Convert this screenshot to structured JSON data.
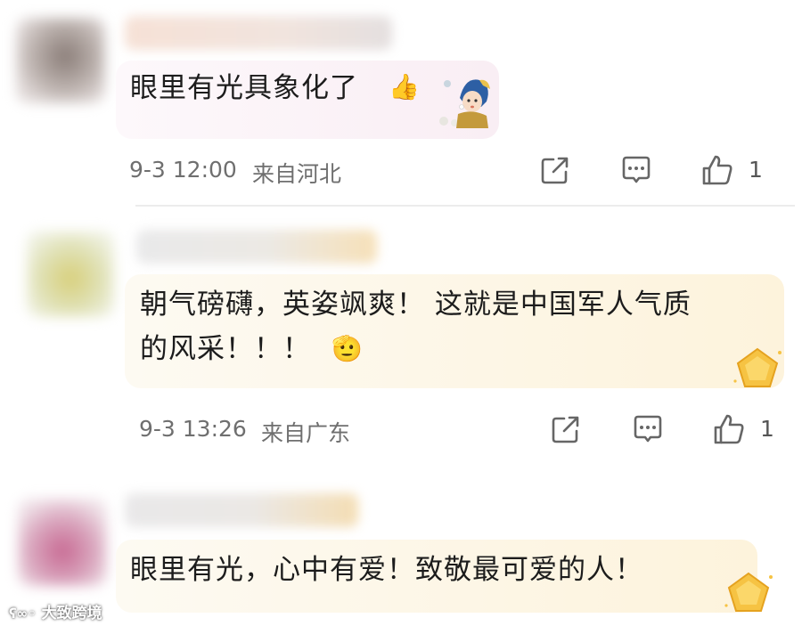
{
  "comments": [
    {
      "text_lines": [
        "眼里有光具象化了"
      ],
      "emojis": [
        "thumbs-up",
        "girl-with-pearl-earring-sticker"
      ],
      "time": "9-3 12:00",
      "location": "来自河北",
      "likes": "1"
    },
    {
      "text_lines": [
        "朝气磅礴，英姿飒爽！ 这就是中国军人气质",
        "的风采！！！"
      ],
      "emojis": [
        "salute-face"
      ],
      "time": "9-3 13:26",
      "location": "来自广东",
      "likes": "1",
      "badge": "gold-pentagon-badge"
    },
    {
      "text_lines": [
        "眼里有光，心中有爱！致敬最可爱的人！"
      ],
      "badge": "gold-pentagon-badge"
    }
  ],
  "watermark": "大致跨境",
  "colors": {
    "bubble1": "#fbf4f7",
    "bubble2": "#fdf5e4",
    "bubble3": "#fdf5e6",
    "meta_text": "#6f6f6f",
    "icon_stroke": "#666666",
    "badge_gold": "#f6c343"
  }
}
